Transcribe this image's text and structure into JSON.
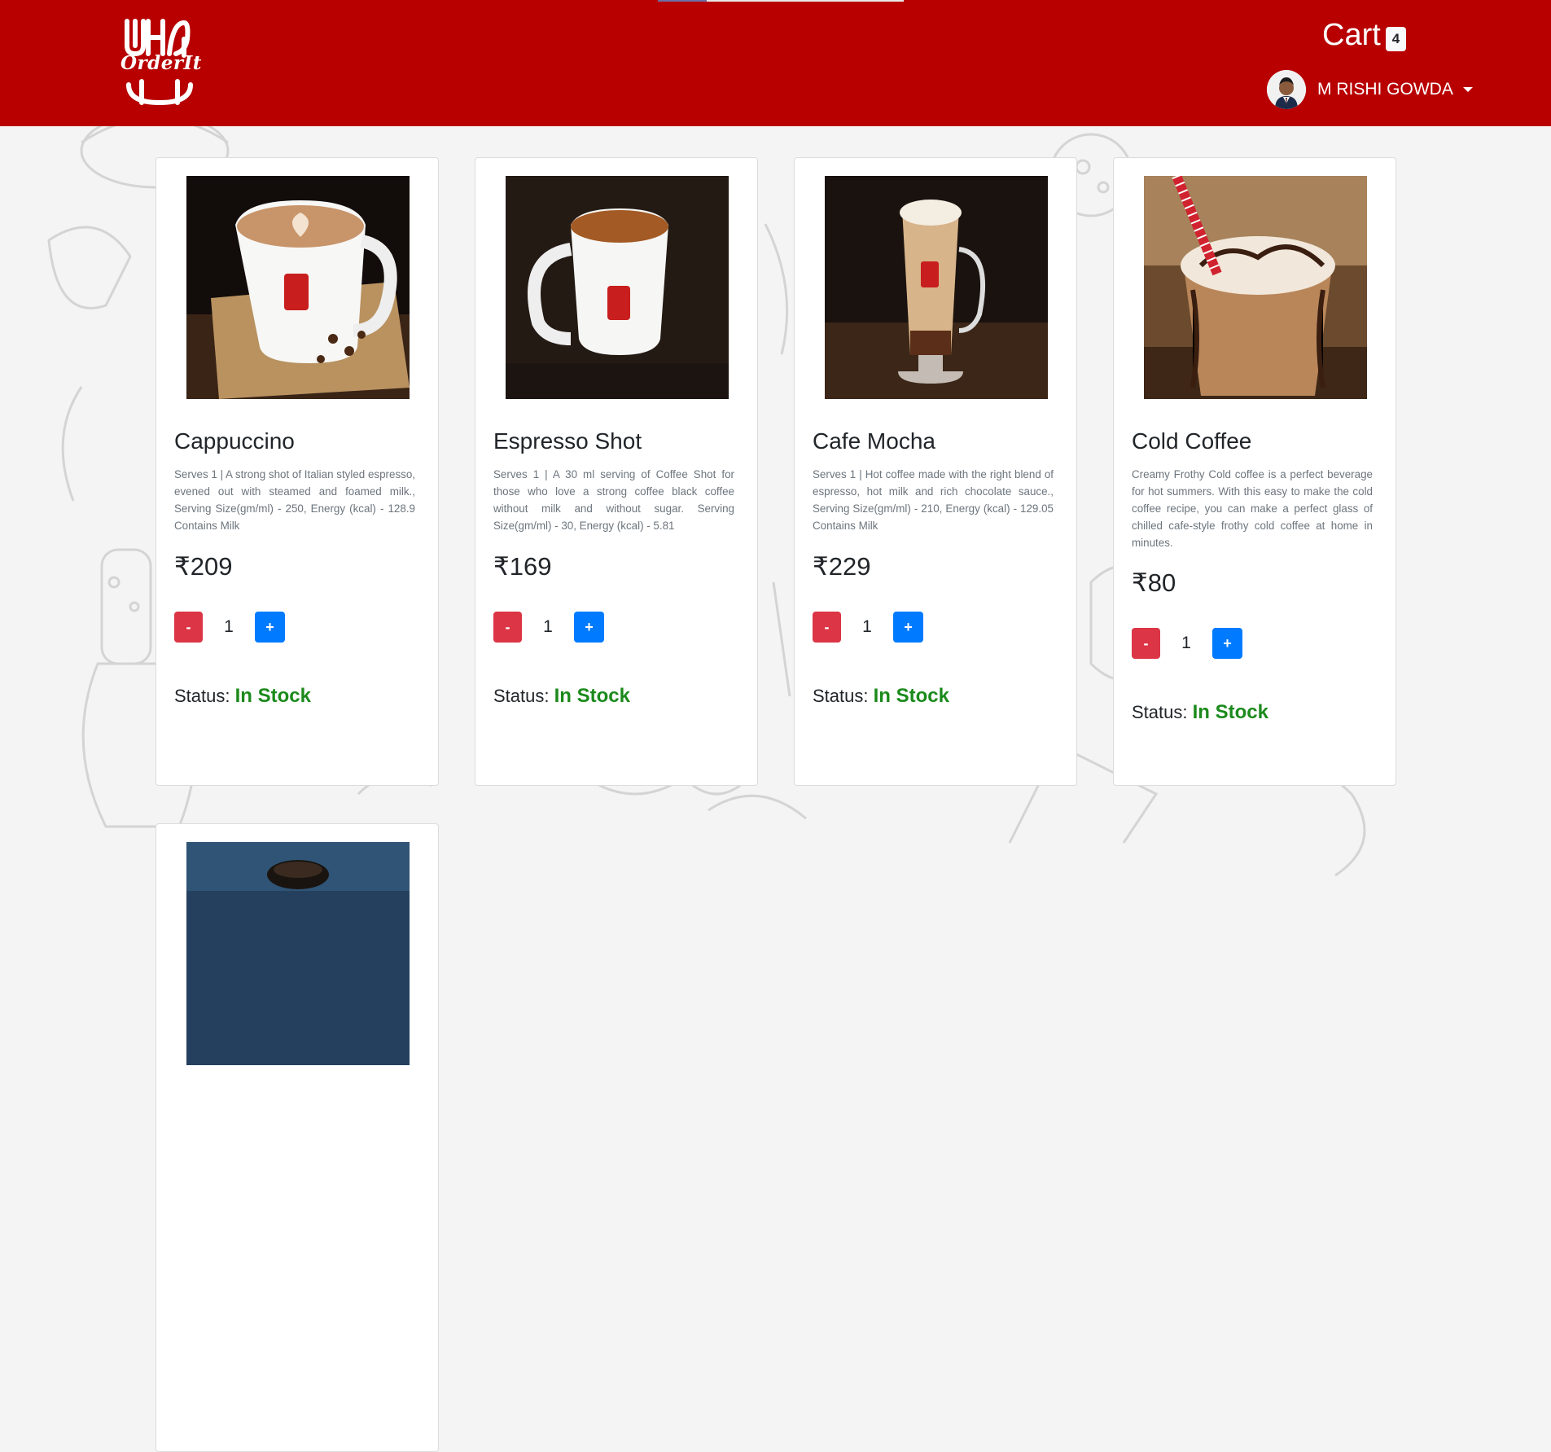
{
  "header": {
    "logo_text": "OrderIt",
    "cart_label": "Cart",
    "cart_count": "4",
    "user_name": "M RISHI GOWDA"
  },
  "products": [
    {
      "title": "Cappuccino",
      "desc": "Serves 1 | A strong shot of Italian styled espresso, evened out with steamed and foamed milk., Serving Size(gm/ml) - 250, Energy (kcal) - 128.9 Contains Milk",
      "price": "₹209",
      "minus": "-",
      "qty": "1",
      "plus": "+",
      "status_label": "Status:",
      "status_value": "In Stock"
    },
    {
      "title": "Espresso Shot",
      "desc": "Serves 1 | A 30 ml serving of Coffee Shot for those who love a strong coffee black coffee without milk and without sugar. Serving Size(gm/ml) - 30, Energy (kcal) - 5.81",
      "price": "₹169",
      "minus": "-",
      "qty": "1",
      "plus": "+",
      "status_label": "Status:",
      "status_value": "In Stock"
    },
    {
      "title": "Cafe Mocha",
      "desc": "Serves 1 | Hot coffee made with the right blend of espresso, hot milk and rich chocolate sauce., Serving Size(gm/ml) - 210, Energy (kcal) - 129.05 Contains Milk",
      "price": "₹229",
      "minus": "-",
      "qty": "1",
      "plus": "+",
      "status_label": "Status:",
      "status_value": "In Stock"
    },
    {
      "title": "Cold Coffee",
      "desc": "Creamy Frothy Cold coffee is a perfect beverage for hot summers. With this easy to make the cold coffee recipe, you can make a perfect glass of chilled cafe-style frothy cold coffee at home in minutes.",
      "price": "₹80",
      "minus": "-",
      "qty": "1",
      "plus": "+",
      "status_label": "Status:",
      "status_value": "In Stock"
    }
  ],
  "colors": {
    "header_bg": "#b80000",
    "minus_btn": "#dc3545",
    "plus_btn": "#007bff",
    "in_stock": "#1b8a1b"
  }
}
